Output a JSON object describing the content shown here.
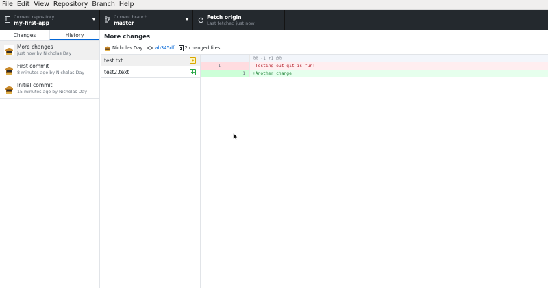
{
  "menu": [
    "File",
    "Edit",
    "View",
    "Repository",
    "Branch",
    "Help"
  ],
  "toolbar": {
    "repo_sub": "Current repository",
    "repo_name": "my-first-app",
    "branch_sub": "Current branch",
    "branch_name": "master",
    "fetch_title": "Fetch origin",
    "fetch_sub": "Last fetched just now"
  },
  "sidebar": {
    "tabs": [
      "Changes",
      "History"
    ],
    "selected_tab": "History",
    "commits": [
      {
        "title": "More changes",
        "meta": "just now by Nicholas Day"
      },
      {
        "title": "First commit",
        "meta": "8 minutes ago by Nicholas Day"
      },
      {
        "title": "Initial commit",
        "meta": "15 minutes ago by Nicholas Day"
      }
    ]
  },
  "summary": {
    "title": "More changes",
    "author": "Nicholas Day",
    "sha": "ab345df",
    "changed_files": "2 changed files"
  },
  "files": [
    {
      "name": "test.txt",
      "status": "modified",
      "status_glyph": "•"
    },
    {
      "name": "test2.text",
      "status": "added",
      "status_glyph": "+"
    }
  ],
  "diff": {
    "lines": [
      {
        "type": "hunk",
        "old": "",
        "new": "",
        "text": "@@ -1 +1 @@"
      },
      {
        "type": "del",
        "old": "1",
        "new": "",
        "text": "-Testing out git is fun!"
      },
      {
        "type": "add",
        "old": "",
        "new": "1",
        "text": "+Another change"
      }
    ]
  },
  "colors": {
    "toolbar_bg": "#24292e",
    "accent": "#0366d6",
    "added": "#28a745",
    "deleted": "#b31d28",
    "modified": "#d9a800"
  }
}
